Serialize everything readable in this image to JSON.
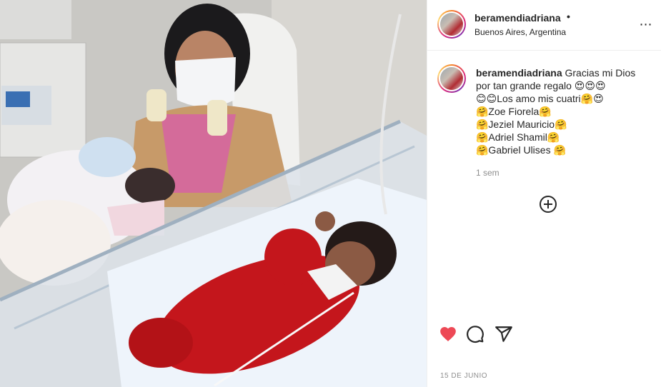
{
  "post": {
    "username": "beramendiadriana",
    "separator": "•",
    "location": "Buenos Aires, Argentina",
    "more_icon": "⋯",
    "caption": {
      "username": "beramendiadriana",
      "lines": [
        "Gracias mi Dios",
        "por tan grande regalo 😍😍😍",
        "😊😊Los amo mis cuatri🤗😍",
        "🤗Zoe Fiorela🤗",
        "🤗Jeziel Mauricio🤗",
        "🤗Adriel Shamil🤗",
        "🤗Gabriel Ulises 🤗"
      ]
    },
    "time_ago": "1 sem",
    "date": "15 DE JUNIO",
    "liked": true,
    "colors": {
      "like_red": "#ed4956",
      "text": "#262626",
      "muted": "#8e8e8e"
    }
  },
  "icons": {
    "like": "heart-icon",
    "comment": "comment-icon",
    "share": "share-icon",
    "add": "plus-circle-icon",
    "more": "more-options-icon"
  }
}
